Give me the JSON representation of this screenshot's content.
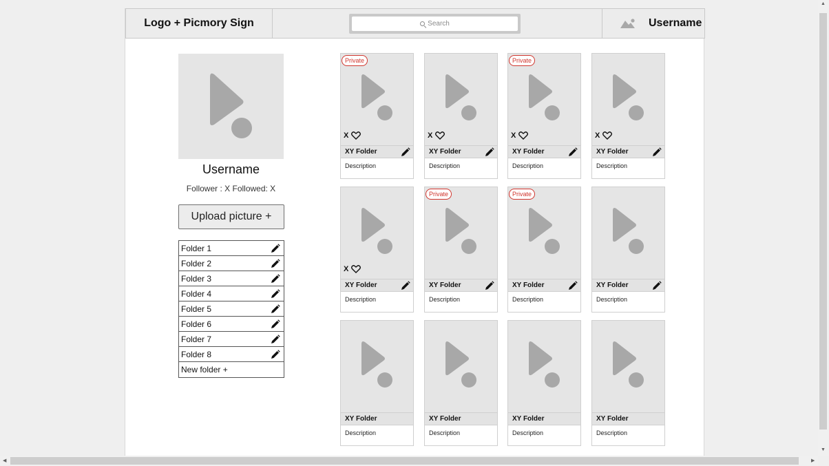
{
  "header": {
    "logo_text": "Logo + Picmory Sign",
    "search_placeholder": "Search",
    "username": "Username"
  },
  "profile": {
    "username": "Username",
    "follow_info": "Follower : X Followed: X",
    "upload_label": "Upload picture +"
  },
  "folders": {
    "items": [
      {
        "label": "Folder 1"
      },
      {
        "label": "Folder 2"
      },
      {
        "label": "Folder 3"
      },
      {
        "label": "Folder 4"
      },
      {
        "label": "Folder 5"
      },
      {
        "label": "Folder 6"
      },
      {
        "label": "Folder 7"
      },
      {
        "label": "Folder 8"
      }
    ],
    "new_folder_label": "New folder +"
  },
  "cards": [
    {
      "private_label": "Private",
      "likes": "X",
      "folder": "XY Folder",
      "description": "Description"
    },
    {
      "private_label": "",
      "likes": "X",
      "folder": "XY Folder",
      "description": "Description"
    },
    {
      "private_label": "Private",
      "likes": "X",
      "folder": "XY Folder",
      "description": "Description"
    },
    {
      "private_label": "",
      "likes": "X",
      "folder": "XY Folder",
      "description": "Description"
    },
    {
      "private_label": "",
      "likes": "X",
      "folder": "XY Folder",
      "description": "Description"
    },
    {
      "private_label": "Private",
      "likes": "",
      "folder": "XY Folder",
      "description": "Description"
    },
    {
      "private_label": "Private",
      "likes": "",
      "folder": "XY Folder",
      "description": "Description"
    },
    {
      "private_label": "",
      "likes": "",
      "folder": "XY Folder",
      "description": "Description"
    },
    {
      "private_label": "",
      "likes": "",
      "folder": "XY Folder",
      "description": "Description"
    },
    {
      "private_label": "",
      "likes": "",
      "folder": "XY Folder",
      "description": "Description"
    },
    {
      "private_label": "",
      "likes": "",
      "folder": "XY Folder",
      "description": "Description"
    },
    {
      "private_label": "",
      "likes": "",
      "folder": "XY Folder",
      "description": "Description"
    }
  ],
  "colors": {
    "private_badge": "#d0352d",
    "placeholder_bg": "#e5e5e5",
    "placeholder_shape": "#a8a8a8",
    "header_bg": "#ececec"
  },
  "icons": {
    "folder_edit": "pencil-icon",
    "card_edit": "pencil-icon",
    "like": "heart-outline-icon",
    "header_user": "image-placeholder-icon",
    "search": "magnifier-icon"
  }
}
